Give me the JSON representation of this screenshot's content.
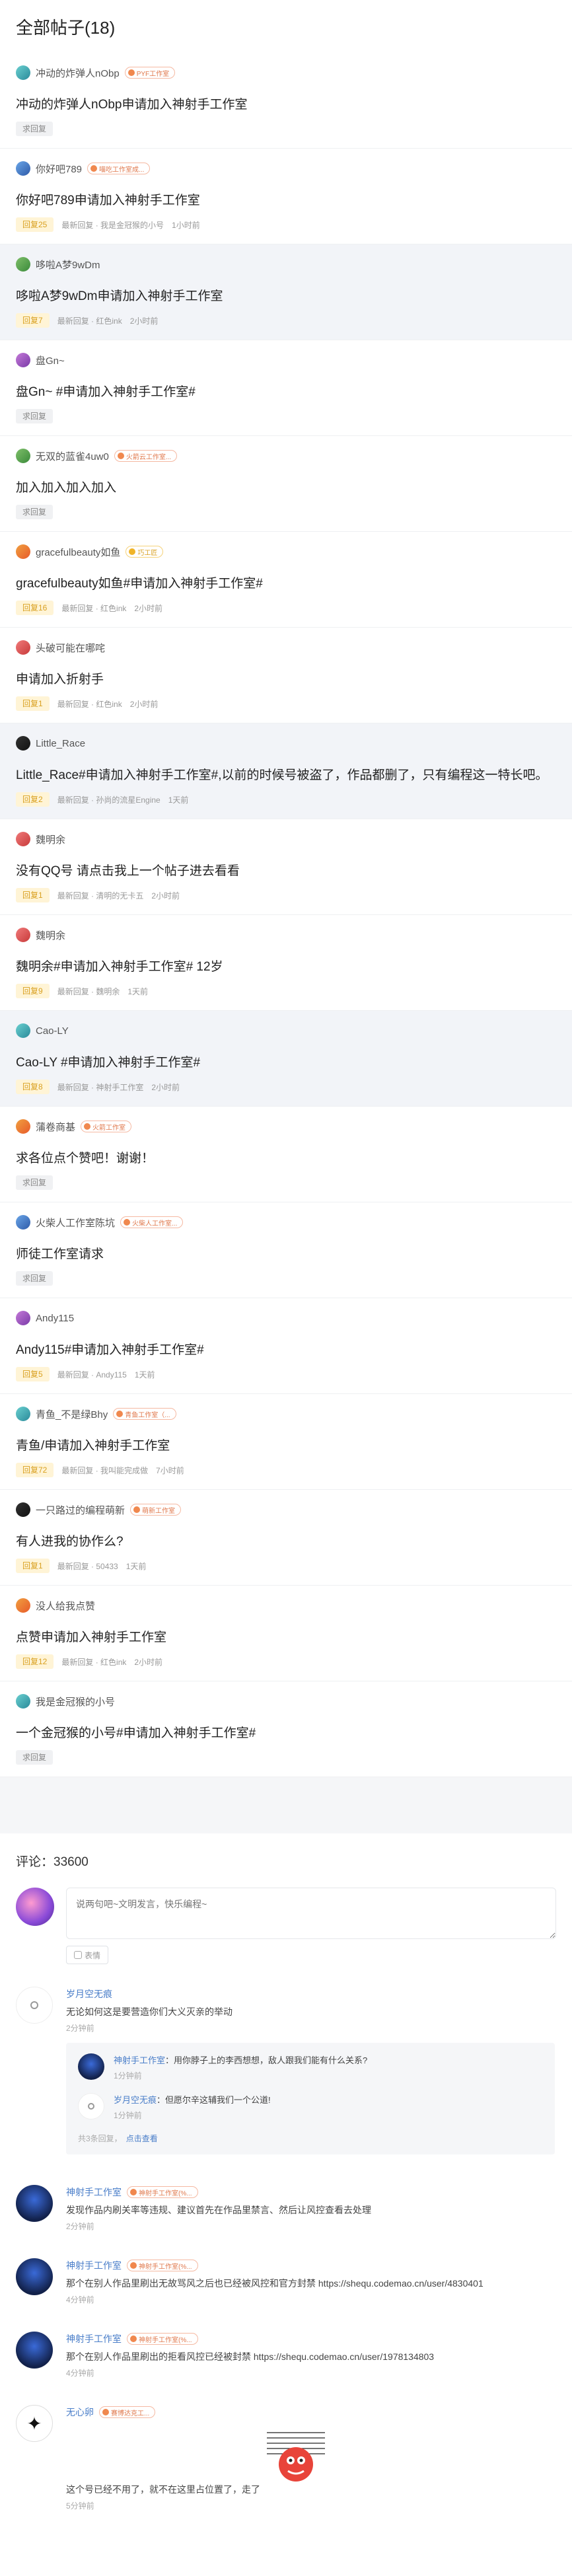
{
  "posts_header": {
    "title": "全部帖子(18)"
  },
  "posts": [
    {
      "author": "冲动的炸弹人nObp",
      "tag": "PYF工作室",
      "title": "冲动的炸弹人nObp申请加入神射手工作室",
      "badge": "求回复",
      "reply_by": "",
      "time": "",
      "highlighted": false
    },
    {
      "author": "你好吧789",
      "tag": "喵吃工作室成...",
      "title": "你好吧789申请加入神射手工作室",
      "badge": "回复25",
      "reply_by": "最新回复 · 我是金冠猴的小号",
      "time": "1小时前",
      "highlighted": false
    },
    {
      "author": "哆啦A梦9wDm",
      "tag": "",
      "title": "哆啦A梦9wDm申请加入神射手工作室",
      "badge": "回复7",
      "reply_by": "最新回复 · 红色ink",
      "time": "2小时前",
      "highlighted": true
    },
    {
      "author": "盘Gn~",
      "tag": "",
      "title": "盘Gn~ #申请加入神射手工作室#",
      "badge": "求回复",
      "reply_by": "",
      "time": "",
      "highlighted": false
    },
    {
      "author": "无双的蓝雀4uw0",
      "tag": "火箭云工作室...",
      "title": "加入加入加入加入",
      "badge": "求回复",
      "reply_by": "",
      "time": "",
      "highlighted": false
    },
    {
      "author": "gracefulbeauty如鱼",
      "tag": "巧工匠",
      "title": "gracefulbeauty如鱼#申请加入神射手工作室#",
      "badge": "回复16",
      "reply_by": "最新回复 · 红色ink",
      "time": "2小时前",
      "highlighted": false
    },
    {
      "author": "头破可能在哪咤",
      "tag": "",
      "title": "申请加入折射手",
      "badge": "回复1",
      "reply_by": "最新回复 · 红色ink",
      "time": "2小时前",
      "highlighted": false
    },
    {
      "author": "Little_Race",
      "tag": "",
      "title": "Little_Race#申请加入神射手工作室#,以前的时候号被盗了，作品都删了，只有编程这一特长吧。",
      "badge": "回复2",
      "reply_by": "最新回复 · 孙尚的流星Engine",
      "time": "1天前",
      "highlighted": true
    },
    {
      "author": "魏明余",
      "tag": "",
      "title": "没有QQ号 请点击我上一个帖子进去看看",
      "badge": "回复1",
      "reply_by": "最新回复 · 清明的无卡五",
      "time": "2小时前",
      "highlighted": false
    },
    {
      "author": "魏明余",
      "tag": "",
      "title": "魏明余#申请加入神射手工作室# 12岁",
      "badge": "回复9",
      "reply_by": "最新回复 · 魏明余",
      "time": "1天前",
      "highlighted": false
    },
    {
      "author": "Cao-LY",
      "tag": "",
      "title": "Cao-LY #申请加入神射手工作室#",
      "badge": "回复8",
      "reply_by": "最新回复 · 神射手工作室",
      "time": "2小时前",
      "highlighted": true
    },
    {
      "author": "蒲卷商基",
      "tag": "火箭工作室",
      "title": "求各位点个赞吧！谢谢！",
      "badge": "求回复",
      "reply_by": "",
      "time": "",
      "highlighted": false
    },
    {
      "author": "火柴人工作室陈坑",
      "tag": "火柴人工作室...",
      "title": "师徒工作室请求",
      "badge": "求回复",
      "reply_by": "",
      "time": "",
      "highlighted": false
    },
    {
      "author": "Andy115",
      "tag": "",
      "title": "Andy115#申请加入神射手工作室#",
      "badge": "回复5",
      "reply_by": "最新回复 · Andy115",
      "time": "1天前",
      "highlighted": false
    },
    {
      "author": "青鱼_不是绿Bhy",
      "tag": "青鱼工作室（...",
      "title": "青鱼/申请加入神射手工作室",
      "badge": "回复72",
      "reply_by": "最新回复 · 我叫能完成做",
      "time": "7小时前",
      "highlighted": false
    },
    {
      "author": "一只路过的编程萌新",
      "tag": "萌新工作室",
      "title": "有人进我的协作么?",
      "badge": "回复1",
      "reply_by": "最新回复 · 50433",
      "time": "1天前",
      "highlighted": false
    },
    {
      "author": "没人给我点赞",
      "tag": "",
      "title": "点赞申请加入神射手工作室",
      "badge": "回复12",
      "reply_by": "最新回复 · 红色ink",
      "time": "2小时前",
      "highlighted": false
    },
    {
      "author": "我是金冠猴的小号",
      "tag": "",
      "title": "一个金冠猴的小号#申请加入神射手工作室#",
      "badge": "求回复",
      "reply_by": "",
      "time": "",
      "highlighted": false
    }
  ],
  "comments_section": {
    "count_label": "评论：33600",
    "input_placeholder": "说两句吧~文明发言，快乐编程~",
    "emoji_label": "表情"
  },
  "comments": [
    {
      "name": "岁月空无痕",
      "tag": "",
      "text": "无论如何这是要营造你们大义灭亲的举动",
      "time": "2分钟前",
      "replies": [
        {
          "name": "神射手工作室",
          "text": "：用你脖子上的李西想想，敌人跟我们能有什么关系?",
          "time": "1分钟前"
        },
        {
          "name": "岁月空无痕",
          "text": "：但愿尔辛这辅我们一个公道!",
          "time": "1分钟前"
        }
      ],
      "replies_footer": "共3条回复，",
      "more_label": "点击查看"
    },
    {
      "name": "神射手工作室",
      "tag": "神射手工作室(%...",
      "text": "发现作品内刷关率等违规、建议首先在作品里禁言、然后让风控查看去处理",
      "time": "2分钟前"
    },
    {
      "name": "神射手工作室",
      "tag": "神射手工作室(%...",
      "text": "那个在别人作品里刷出无故骂风之后也已经被风控和官方封禁 https://shequ.codemao.cn/user/4830401",
      "time": "4分钟前"
    },
    {
      "name": "神射手工作室",
      "tag": "神射手工作室(%...",
      "text": "那个在别人作品里刷出的拒看风控已经被封禁 https://shequ.codemao.cn/user/1978134803",
      "time": "4分钟前"
    },
    {
      "name": "无心卵",
      "tag": "赛博达克工...",
      "text": "这个号已经不用了，就不在这里占位置了，走了",
      "time": "5分钟前"
    }
  ],
  "colors": {
    "accent_blue": "#4a7ec9",
    "badge_yellow": "#d9a020",
    "tag_orange": "#e0784c",
    "highlight_bg": "#f2f4f8"
  },
  "icons": {
    "reply_avatar_placeholder": "user-placeholder-icon",
    "emoji": "emoji-icon",
    "tag_medal": "medal-icon"
  }
}
